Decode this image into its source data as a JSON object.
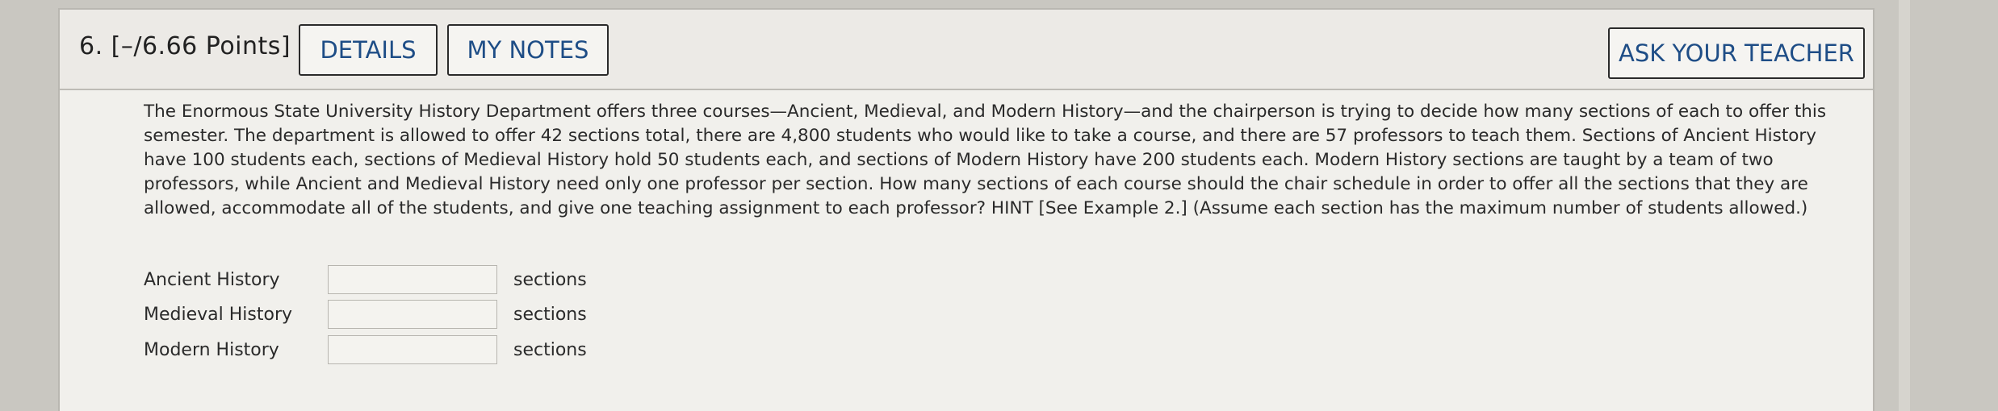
{
  "question": {
    "number_points": "6.  [–/6.66 Points]"
  },
  "header": {
    "details_label": "DETAILS",
    "notes_label": "MY NOTES",
    "ask_label": "ASK YOUR TEACHER"
  },
  "problem": {
    "text": "The Enormous State University History Department offers three courses—Ancient, Medieval, and Modern History—and the chairperson is trying to decide how many sections of each to offer this semester. The department is allowed to offer 42 sections total, there are 4,800 students who would like to take a course, and there are 57 professors to teach them. Sections of Ancient History have 100 students each, sections of Medieval History hold 50 students each, and sections of Modern History have 200 students each. Modern History sections are taught by a team of two professors, while Ancient and Medieval History need only one professor per section. How many sections of each course should the chair schedule in order to offer all the sections that they are allowed, accommodate all of the students, and give one teaching assignment to each professor? HINT [See Example 2.] (Assume each section has the maximum number of students allowed.)"
  },
  "answers": [
    {
      "label": "Ancient History",
      "value": "",
      "unit": "sections"
    },
    {
      "label": "Medieval History",
      "value": "",
      "unit": "sections"
    },
    {
      "label": "Modern History",
      "value": "",
      "unit": "sections"
    }
  ]
}
